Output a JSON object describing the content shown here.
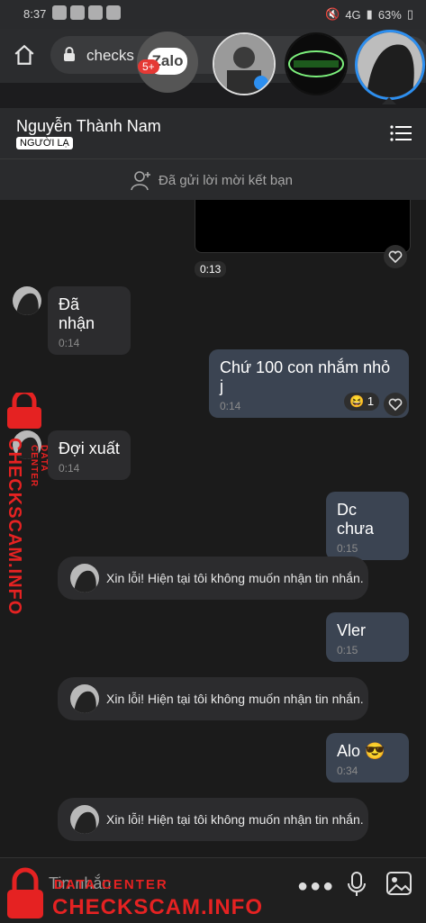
{
  "status": {
    "time": "8:37",
    "network": "4G",
    "battery": "63%"
  },
  "browser": {
    "url": "checks"
  },
  "chatheads": {
    "badge": "5+",
    "zalo_label": "Zalo"
  },
  "header": {
    "name": "Nguyễn Thành Nam",
    "tag": "NGƯỜI LẠ"
  },
  "friend_request": {
    "text": "Đã gửi lời mời kết bạn"
  },
  "video": {
    "time": "0:13"
  },
  "messages": [
    {
      "side": "in",
      "text": "Đã nhận",
      "time": "0:14"
    },
    {
      "side": "out",
      "text": "Chứ 100 con nhắm nhỏ j",
      "time": "0:14",
      "reaction_count": "1"
    },
    {
      "side": "in",
      "text": "Đợi xuất",
      "time": "0:14"
    },
    {
      "side": "out",
      "text": "Dc chưa",
      "time": "0:15"
    },
    {
      "side": "system",
      "text": "Xin lỗi! Hiện tại tôi không muốn nhận tin nhắn."
    },
    {
      "side": "out",
      "text": "Vler",
      "time": "0:15"
    },
    {
      "side": "system",
      "text": "Xin lỗi! Hiện tại tôi không muốn nhận tin nhắn."
    },
    {
      "side": "out",
      "text": "Alo 😎",
      "time": "0:34"
    },
    {
      "side": "system",
      "text": "Xin lỗi! Hiện tại tôi không muốn nhận tin nhắn."
    }
  ],
  "input": {
    "placeholder": "Tin nhắn"
  },
  "watermark": {
    "brand": "CHECKSCAM.INFO",
    "sub": "DATA CENTER"
  }
}
